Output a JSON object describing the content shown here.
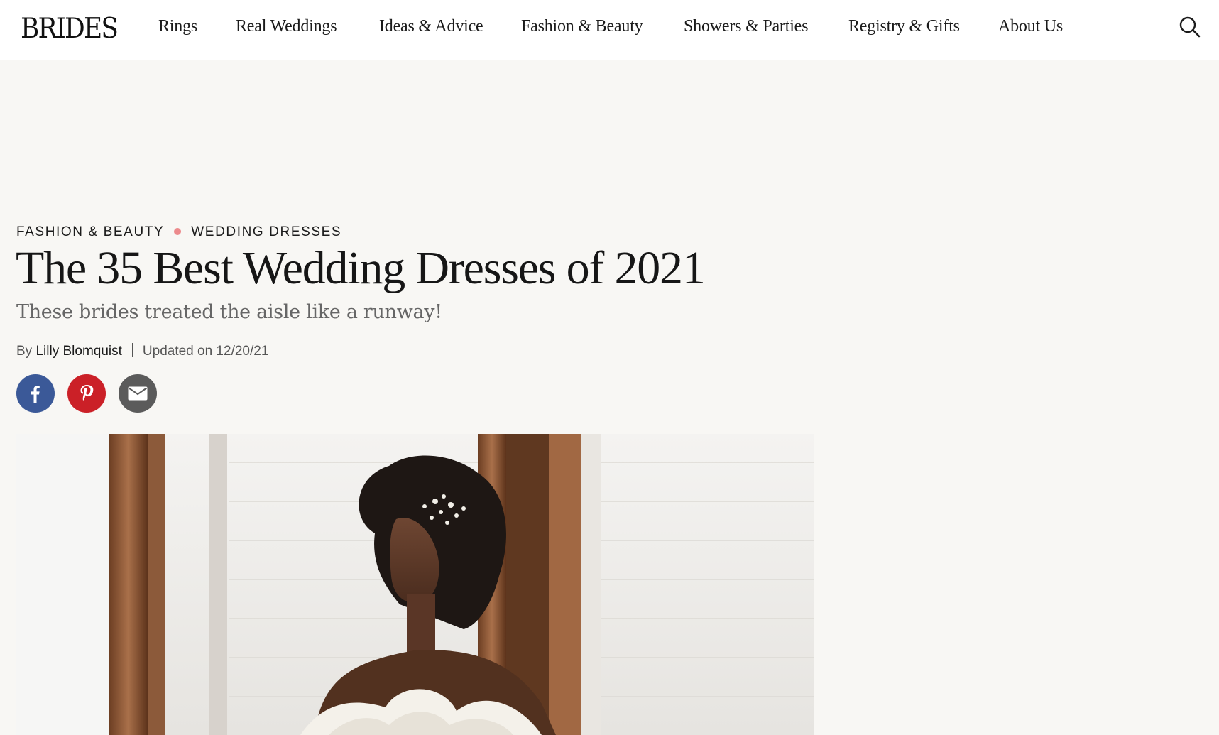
{
  "header": {
    "logo": "BRIDES",
    "nav": [
      {
        "label": "Rings"
      },
      {
        "label": "Real Weddings"
      },
      {
        "label": "Ideas & Advice"
      },
      {
        "label": "Fashion & Beauty"
      },
      {
        "label": "Showers & Parties"
      },
      {
        "label": "Registry & Gifts"
      },
      {
        "label": "About Us"
      }
    ],
    "search_icon": "search-icon"
  },
  "article": {
    "breadcrumb": [
      "FASHION & BEAUTY",
      "WEDDING DRESSES"
    ],
    "title": "The 35 Best Wedding Dresses of 2021",
    "subtitle": "These brides treated the aisle like a runway!",
    "byline": {
      "prefix": "By",
      "author": "Lilly Blomquist",
      "updated": "Updated on 12/20/21"
    },
    "share": [
      {
        "icon": "facebook-icon",
        "color": "#3b5998"
      },
      {
        "icon": "pinterest-icon",
        "color": "#cb2027"
      },
      {
        "icon": "email-icon",
        "color": "#5b5b5b"
      }
    ]
  },
  "colors": {
    "page_bg": "#f8f7f4",
    "breadcrumb_dot": "#ec8a8c"
  }
}
